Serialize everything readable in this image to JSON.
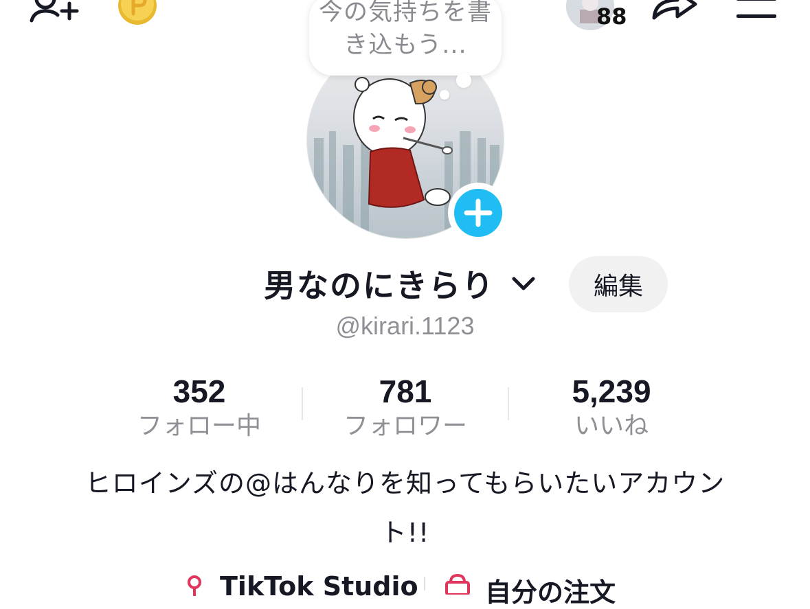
{
  "header": {
    "notification_count": "88"
  },
  "status_bubble": {
    "text": "今の気持ちを書き込もう..."
  },
  "profile": {
    "display_name": "男なのにきらり",
    "username": "@kirari.1123",
    "edit_label": "編集",
    "bio": "ヒロインズの@はんなりを知ってもらいたいアカウント!!"
  },
  "stats": [
    {
      "value": "352",
      "label": "フォロー中"
    },
    {
      "value": "781",
      "label": "フォロワー"
    },
    {
      "value": "5,239",
      "label": "いいね"
    }
  ],
  "links": {
    "studio": "TikTok Studio",
    "orders": "自分の注文"
  },
  "icons": {
    "add_user": "add-user-icon",
    "coin": "coin-icon",
    "share": "share-icon",
    "menu": "menu-icon",
    "add_photo": "plus-icon",
    "chevron": "chevron-down-icon"
  },
  "colors": {
    "accent_blue": "#20bdf4",
    "coin_gold": "#f2c94c",
    "text_primary": "#161823",
    "text_secondary": "#8f9095"
  }
}
